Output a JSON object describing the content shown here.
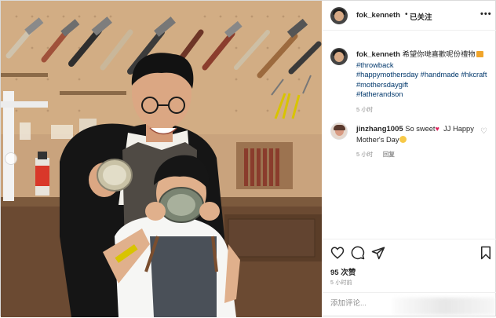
{
  "header": {
    "username": "fok_kenneth",
    "separator": "•",
    "follow_label": "已关注",
    "more_label": "•••"
  },
  "caption": {
    "username": "fok_kenneth",
    "text": "希望你哋喜歡呢份禮物",
    "hashtags": [
      "#throwback",
      "#happymothersday",
      "#handmade",
      "#hkcraft",
      "#mothersdaygift",
      "#fatherandson"
    ],
    "time": "5 小时"
  },
  "comment": {
    "username": "jinzhang1005",
    "text_before": "So sweet",
    "text_after": " JJ Happy Mother's Day",
    "time": "5 小时",
    "reply_label": "回复"
  },
  "actions": {
    "like_icon": "heart-icon",
    "comment_icon": "comment-icon",
    "share_icon": "share-icon",
    "save_icon": "bookmark-icon"
  },
  "likes": "95 次赞",
  "posted_ago": "5 小时前",
  "add_comment_placeholder": "添加评论...",
  "colors": {
    "link": "#00376b",
    "muted": "#8e8e8e",
    "heart": "#e0245e"
  }
}
